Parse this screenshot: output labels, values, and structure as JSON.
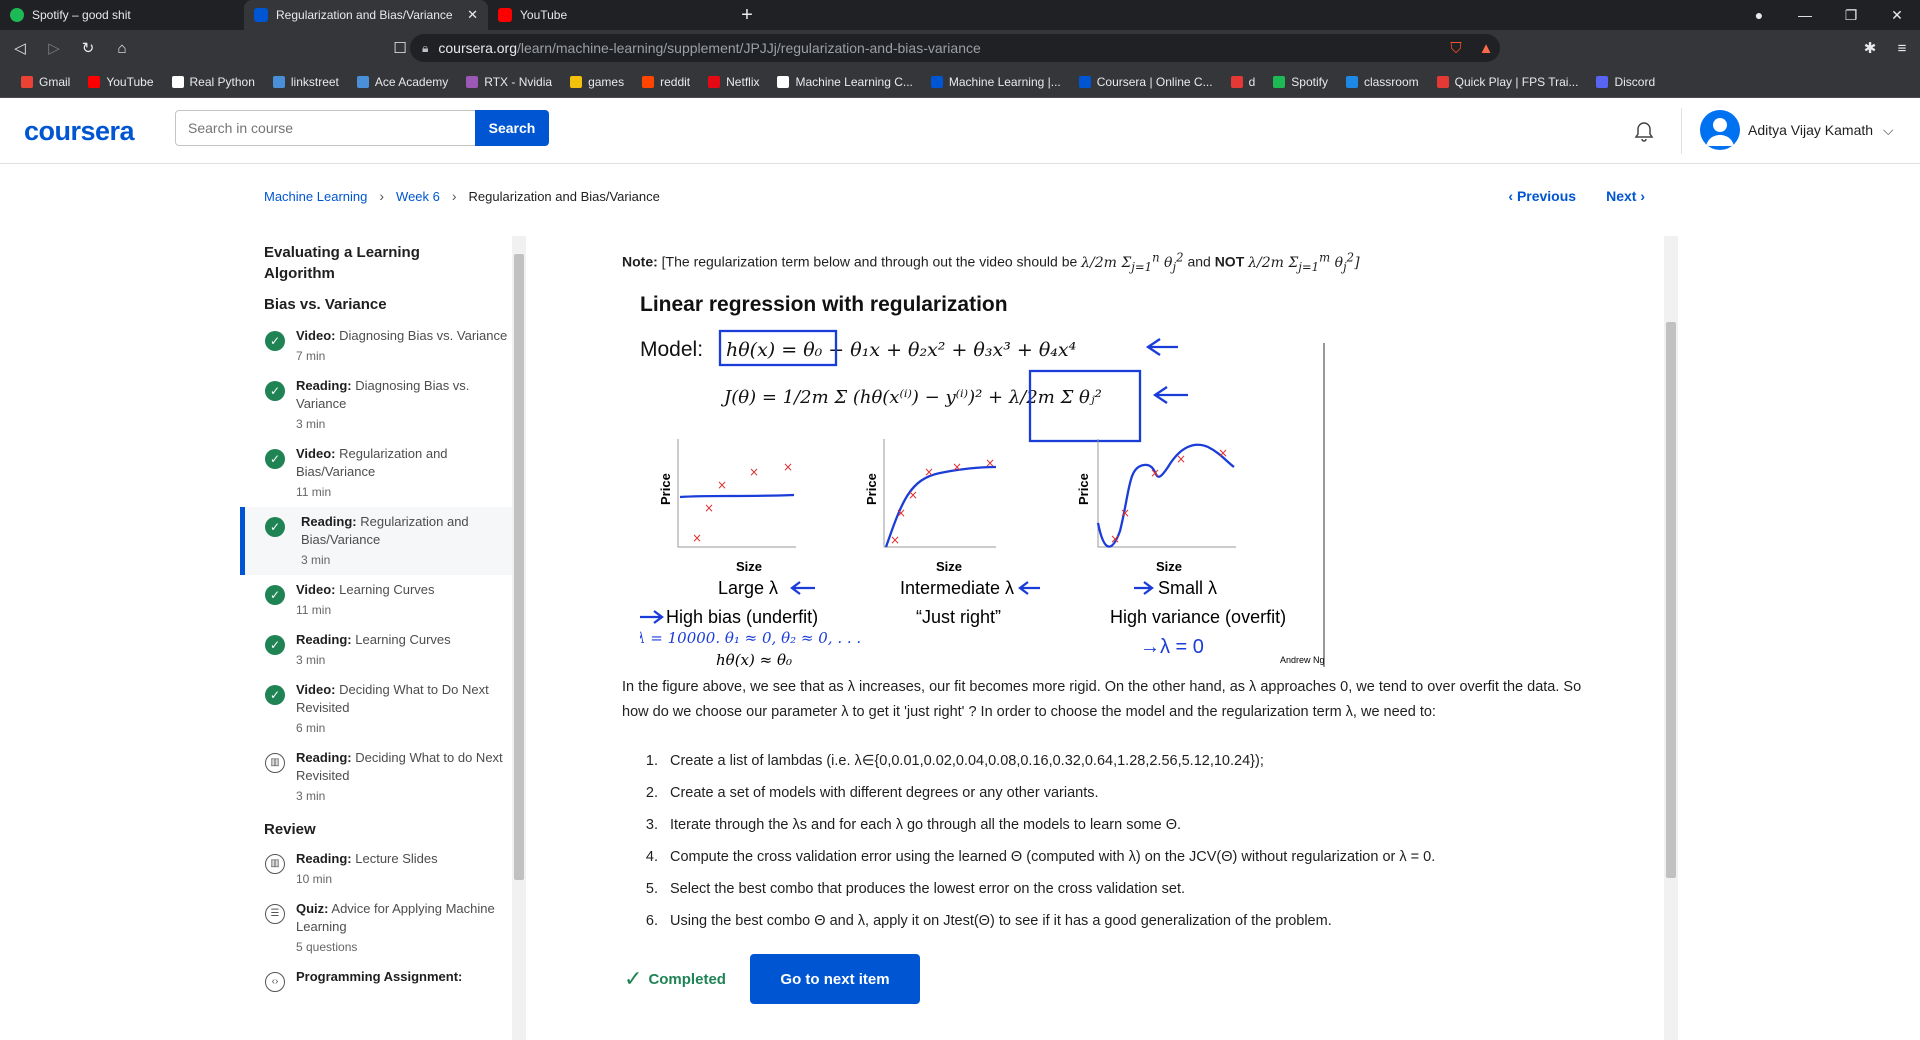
{
  "browser": {
    "tabs": [
      {
        "title": "Spotify – good shit",
        "color": "#1db954"
      },
      {
        "title": "Regularization and Bias/Variance",
        "color": "#0056d2"
      },
      {
        "title": "YouTube",
        "color": "#ff0000"
      }
    ],
    "url_domain": "coursera.org",
    "url_path": "/learn/machine-learning/supplement/JPJJj/regularization-and-bias-variance",
    "bookmarks": [
      {
        "label": "Gmail",
        "color": "#ea4335"
      },
      {
        "label": "YouTube",
        "color": "#ff0000"
      },
      {
        "label": "Real Python",
        "color": "#ffffff"
      },
      {
        "label": "linkstreet",
        "color": "#4a90d9"
      },
      {
        "label": "Ace Academy",
        "color": "#4a90d9"
      },
      {
        "label": "RTX - Nvidia",
        "color": "#9b59b6"
      },
      {
        "label": "games",
        "color": "#f4c20d"
      },
      {
        "label": "reddit",
        "color": "#ff4500"
      },
      {
        "label": "Netflix",
        "color": "#e50914"
      },
      {
        "label": "Machine Learning C...",
        "color": "#ffffff"
      },
      {
        "label": "Machine Learning |...",
        "color": "#0056d2"
      },
      {
        "label": "Coursera | Online C...",
        "color": "#0056d2"
      },
      {
        "label": "d",
        "color": "#e53935"
      },
      {
        "label": "Spotify",
        "color": "#1db954"
      },
      {
        "label": "classroom",
        "color": "#1e88e5"
      },
      {
        "label": "Quick Play | FPS Trai...",
        "color": "#e53935"
      },
      {
        "label": "Discord",
        "color": "#5865f2"
      }
    ]
  },
  "header": {
    "logo": "coursera",
    "search_placeholder": "Search in course",
    "search_button": "Search",
    "user_name": "Aditya Vijay Kamath"
  },
  "breadcrumb": [
    "Machine Learning",
    "Week 6",
    "Regularization and Bias/Variance"
  ],
  "nav": {
    "previous": "Previous",
    "next": "Next"
  },
  "sidebar": {
    "group1": "Evaluating a Learning Algorithm",
    "group2": "Bias vs. Variance",
    "group3": "Review",
    "items": [
      {
        "type": "Video:",
        "title": "Diagnosing Bias vs. Variance",
        "duration": "7 min"
      },
      {
        "type": "Reading:",
        "title": "Diagnosing Bias vs. Variance",
        "duration": "3 min"
      },
      {
        "type": "Video:",
        "title": "Regularization and Bias/Variance",
        "duration": "11 min"
      },
      {
        "type": "Reading:",
        "title": "Regularization and Bias/Variance",
        "duration": "3 min"
      },
      {
        "type": "Video:",
        "title": "Learning Curves",
        "duration": "11 min"
      },
      {
        "type": "Reading:",
        "title": "Learning Curves",
        "duration": "3 min"
      },
      {
        "type": "Video:",
        "title": "Deciding What to Do Next Revisited",
        "duration": "6 min"
      },
      {
        "type": "Reading:",
        "title": "Deciding What to do Next Revisited",
        "duration": "3 min"
      },
      {
        "type": "Reading:",
        "title": "Lecture Slides",
        "duration": "10 min"
      },
      {
        "type": "Quiz:",
        "title": "Advice for Applying Machine Learning",
        "duration": "5 questions"
      },
      {
        "type": "Programming Assignment:",
        "title": "",
        "duration": ""
      }
    ]
  },
  "content": {
    "note_label": "Note:",
    "note_text": "[The regularization term below and through out the video should be",
    "note_and": "and",
    "note_not": "NOT",
    "slide": {
      "title": "Linear regression with regularization",
      "model_label": "Model:",
      "price": "Price",
      "size": "Size",
      "large": "Large λ",
      "intermediate": "Intermediate λ",
      "small": "Small λ",
      "high_bias": "High bias (underfit)",
      "just_right": "“Just right”",
      "high_variance": "High variance (overfit)",
      "lambda_line": "λ = 10000.  θ₁ ≈ 0, θ₂ ≈ 0, . . .",
      "h_approx": "hθ(x) ≈ θ₀",
      "lambda_zero": "→λ = 0",
      "credit": "Andrew Ng"
    },
    "paragraph": "In the figure above, we see that as λ increases, our fit becomes more rigid. On the other hand, as λ approaches 0, we tend to over overfit the data. So how do we choose our parameter λ to get it 'just right' ? In order to choose the model and the regularization term λ, we need to:",
    "steps": [
      "Create a list of lambdas (i.e. λ∈{0,0.01,0.02,0.04,0.08,0.16,0.32,0.64,1.28,2.56,5.12,10.24});",
      "Create a set of models with different degrees or any other variants.",
      "Iterate through the λs and for each λ go through all the models to learn some Θ.",
      "Compute the cross validation error using the learned Θ (computed with λ) on the JCV(Θ) without regularization or λ = 0.",
      "Select the best combo that produces the lowest error on the cross validation set.",
      "Using the best combo Θ and λ, apply it on Jtest(Θ) to see if it has a good generalization of the problem."
    ],
    "completed": "Completed",
    "next_button": "Go to next item"
  }
}
